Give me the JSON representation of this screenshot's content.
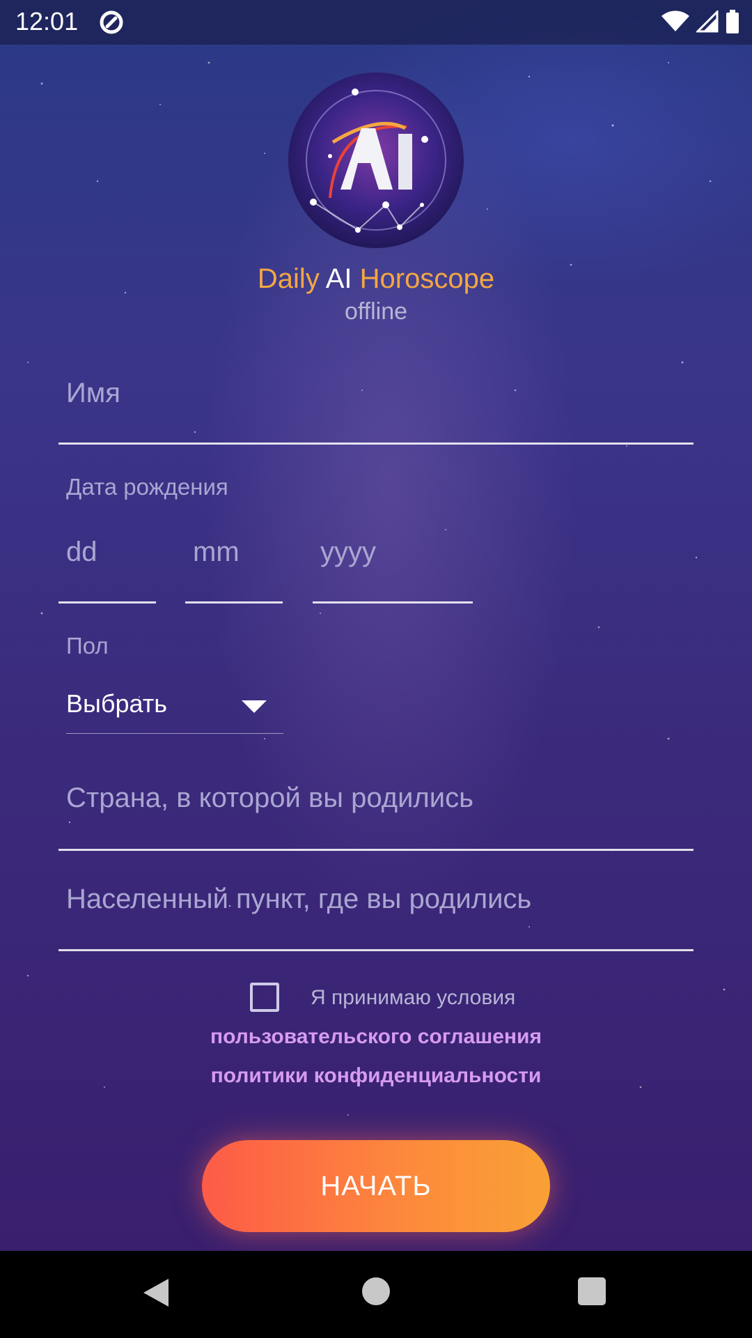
{
  "status_bar": {
    "time": "12:01"
  },
  "app": {
    "title_part1": "Daily",
    "title_part2": "AI",
    "title_part3": "Horoscope",
    "subtitle": "offline",
    "logo_text": "AI"
  },
  "form": {
    "name_placeholder": "Имя",
    "birthdate_label": "Дата рождения",
    "day_placeholder": "dd",
    "month_placeholder": "mm",
    "year_placeholder": "yyyy",
    "gender_label": "Пол",
    "gender_value": "Выбрать",
    "country_placeholder": "Страна, в которой вы родились",
    "city_placeholder": "Населенный пункт, где вы родились",
    "terms_text": "Я принимаю условия",
    "terms_checked": false,
    "user_agreement_link": "пользовательского соглашения",
    "privacy_policy_link": "политики конфиденциальности",
    "start_button": "НАЧАТЬ"
  },
  "colors": {
    "accent": "#f4a742",
    "link": "#d69bf0",
    "button_start": "#fd5b47",
    "button_end": "#f9a135"
  }
}
